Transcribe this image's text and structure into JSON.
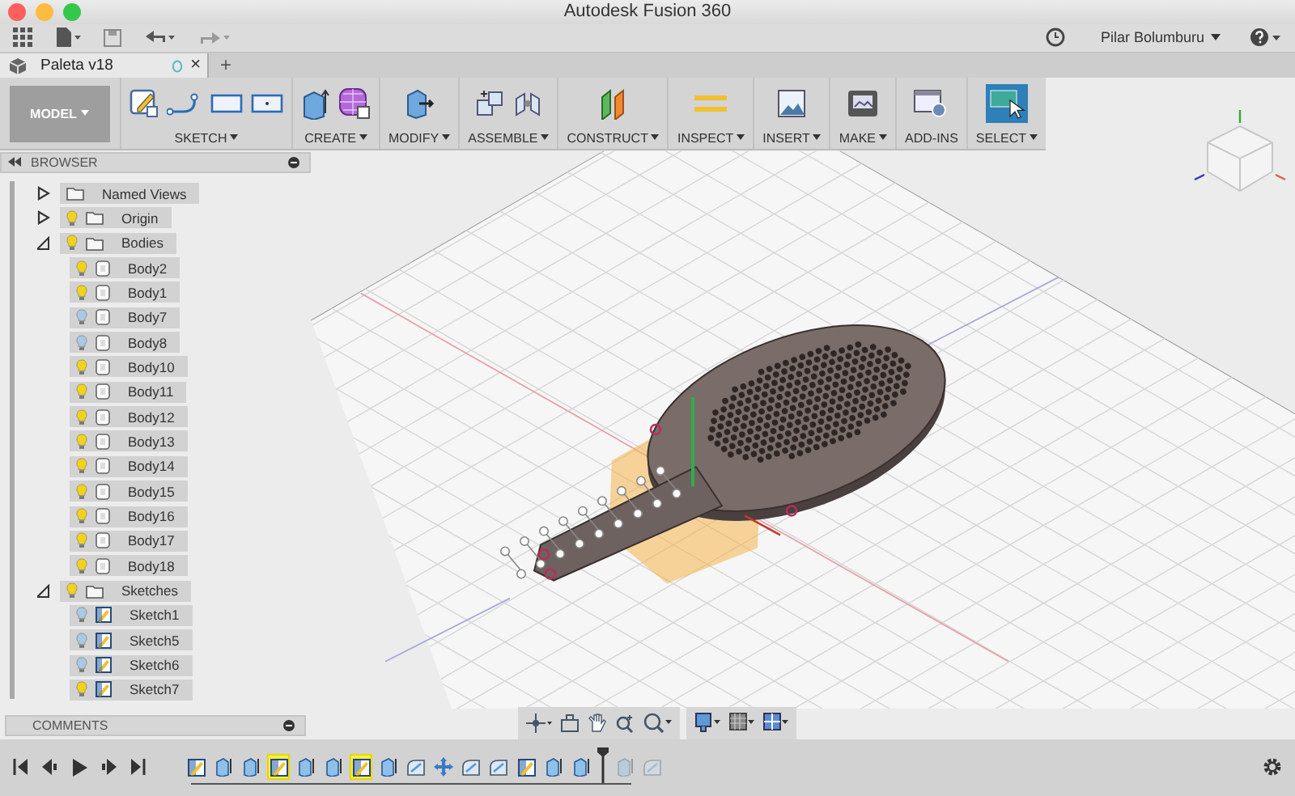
{
  "window": {
    "title": "Autodesk Fusion 360"
  },
  "app_bar": {
    "user": "Pilar Bolumburu"
  },
  "document_tab": {
    "title": "Paleta v18",
    "close": "×",
    "new_tab": "+"
  },
  "ribbon": {
    "workspace": "MODEL",
    "groups": [
      {
        "label": "SKETCH",
        "menu": true
      },
      {
        "label": "CREATE",
        "menu": true
      },
      {
        "label": "MODIFY",
        "menu": true
      },
      {
        "label": "ASSEMBLE",
        "menu": true
      },
      {
        "label": "CONSTRUCT",
        "menu": true
      },
      {
        "label": "INSPECT",
        "menu": true
      },
      {
        "label": "INSERT",
        "menu": true
      },
      {
        "label": "MAKE",
        "menu": true
      },
      {
        "label": "ADD-INS",
        "menu": false
      },
      {
        "label": "SELECT",
        "menu": true
      }
    ]
  },
  "browser": {
    "title": "BROWSER",
    "tree": [
      {
        "label": "Named Views",
        "kind": "folder",
        "expanded": false
      },
      {
        "label": "Origin",
        "kind": "folder",
        "visible": true,
        "expanded": false
      },
      {
        "label": "Bodies",
        "kind": "folder",
        "visible": true,
        "expanded": true,
        "children": [
          {
            "label": "Body2",
            "kind": "body",
            "visible": true
          },
          {
            "label": "Body1",
            "kind": "body",
            "visible": true
          },
          {
            "label": "Body7",
            "kind": "body",
            "visible": false
          },
          {
            "label": "Body8",
            "kind": "body",
            "visible": false
          },
          {
            "label": "Body10",
            "kind": "body",
            "visible": true
          },
          {
            "label": "Body11",
            "kind": "body",
            "visible": true
          },
          {
            "label": "Body12",
            "kind": "body",
            "visible": true
          },
          {
            "label": "Body13",
            "kind": "body",
            "visible": true
          },
          {
            "label": "Body14",
            "kind": "body",
            "visible": true
          },
          {
            "label": "Body15",
            "kind": "body",
            "visible": true
          },
          {
            "label": "Body16",
            "kind": "body",
            "visible": true
          },
          {
            "label": "Body17",
            "kind": "body",
            "visible": true
          },
          {
            "label": "Body18",
            "kind": "body",
            "visible": true
          }
        ]
      },
      {
        "label": "Sketches",
        "kind": "folder",
        "visible": true,
        "expanded": true,
        "children": [
          {
            "label": "Sketch1",
            "kind": "sketch",
            "visible": false
          },
          {
            "label": "Sketch5",
            "kind": "sketch",
            "visible": false
          },
          {
            "label": "Sketch6",
            "kind": "sketch",
            "visible": false
          },
          {
            "label": "Sketch7",
            "kind": "sketch",
            "visible": true
          }
        ]
      }
    ]
  },
  "comments": {
    "title": "COMMENTS"
  },
  "timeline": {
    "items": [
      {
        "kind": "sketch",
        "selected": false,
        "rolled_back": false
      },
      {
        "kind": "extrude",
        "selected": false,
        "rolled_back": false
      },
      {
        "kind": "extrude",
        "selected": false,
        "rolled_back": false
      },
      {
        "kind": "sketch",
        "selected": true,
        "rolled_back": false
      },
      {
        "kind": "extrude",
        "selected": false,
        "rolled_back": false
      },
      {
        "kind": "extrude",
        "selected": false,
        "rolled_back": false
      },
      {
        "kind": "sketch",
        "selected": true,
        "rolled_back": false
      },
      {
        "kind": "extrude",
        "selected": false,
        "rolled_back": false
      },
      {
        "kind": "fillet",
        "selected": false,
        "rolled_back": false
      },
      {
        "kind": "move",
        "selected": false,
        "rolled_back": false
      },
      {
        "kind": "fillet",
        "selected": false,
        "rolled_back": false
      },
      {
        "kind": "fillet",
        "selected": false,
        "rolled_back": false
      },
      {
        "kind": "sketch",
        "selected": false,
        "rolled_back": false
      },
      {
        "kind": "extrude",
        "selected": false,
        "rolled_back": false
      },
      {
        "kind": "extrude",
        "selected": false,
        "rolled_back": false
      },
      {
        "kind": "marker"
      },
      {
        "kind": "extrude",
        "selected": false,
        "rolled_back": true
      },
      {
        "kind": "fillet",
        "selected": false,
        "rolled_back": true
      }
    ]
  }
}
